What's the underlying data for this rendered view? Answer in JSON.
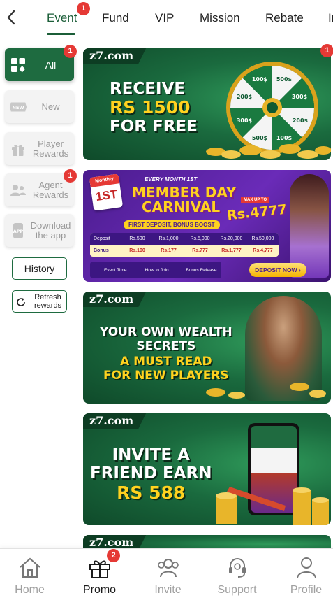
{
  "header": {
    "back_icon": "chevron-left-icon",
    "tabs": [
      {
        "label": "Event",
        "badge": "1",
        "active": true
      },
      {
        "label": "Fund"
      },
      {
        "label": "VIP"
      },
      {
        "label": "Mission"
      },
      {
        "label": "Rebate"
      },
      {
        "label": "In"
      }
    ]
  },
  "sidebar": {
    "items": [
      {
        "label": "All",
        "icon": "grid-icon",
        "badge": "1",
        "active": true
      },
      {
        "label": "New",
        "icon": "new-tag-icon"
      },
      {
        "label": "Player Rewards",
        "icon": "gift-icon"
      },
      {
        "label": "Agent Rewards",
        "icon": "agent-icon",
        "badge": "1"
      },
      {
        "label": "Download the app",
        "icon": "app-download-icon"
      }
    ],
    "history_label": "History",
    "refresh_label": "Refresh rewards"
  },
  "banners": {
    "b1": {
      "logo": "z7.com",
      "line1": "RECEIVE",
      "line2": "RS 1500",
      "line3": "FOR FREE",
      "badge": "1",
      "wheel_labels": [
        "500$",
        "300$",
        "200$",
        "100$",
        "500$",
        "300$",
        "200$",
        "100$"
      ]
    },
    "b2": {
      "monthly_tag": "Monthly",
      "day_tag": "1ST",
      "every_month": "EVERY MONTH 1ST",
      "title1": "MEMBER DAY",
      "title2": "CARNIVAL",
      "max_up_to": "MAX UP TO",
      "amount": "Rs.4777",
      "subtitle": "FIRST DEPOSIT, BONUS BOOST",
      "deposit_label": "Deposit",
      "deposits": [
        "Rs.500",
        "Rs.1,000",
        "Rs.5,000",
        "Rs.20,000",
        "Rs.50,000"
      ],
      "bonus_label": "Bonus",
      "bonuses": [
        "Rs.100",
        "Rs.177",
        "Rs.777",
        "Rs.1,777",
        "Rs.4,777"
      ],
      "event_time": "Event Time",
      "how_to_join": "How to Join",
      "bonus_release": "Bonus Release",
      "cta": "DEPOSIT NOW ›"
    },
    "b3": {
      "logo": "z7.com",
      "line1": "YOUR OWN WEALTH",
      "line2": "SECRETS",
      "line3": "A MUST READ",
      "line4": "FOR NEW PLAYERS"
    },
    "b4": {
      "logo": "z7.com",
      "line1": "INVITE A",
      "line2": "FRIEND EARN",
      "line3": "RS 588"
    },
    "b5": {
      "logo": "z7.com"
    }
  },
  "bottom_nav": {
    "items": [
      {
        "label": "Home",
        "icon": "home-icon"
      },
      {
        "label": "Promo",
        "icon": "gift-box-icon",
        "badge": "2",
        "active": true
      },
      {
        "label": "Invite",
        "icon": "invite-users-icon"
      },
      {
        "label": "Support",
        "icon": "headset-icon"
      },
      {
        "label": "Profile",
        "icon": "user-icon"
      }
    ]
  },
  "colors": {
    "brand_green": "#1e6b40",
    "badge_red": "#e53935",
    "gold": "#ffd21f",
    "purple": "#5b24a6"
  }
}
